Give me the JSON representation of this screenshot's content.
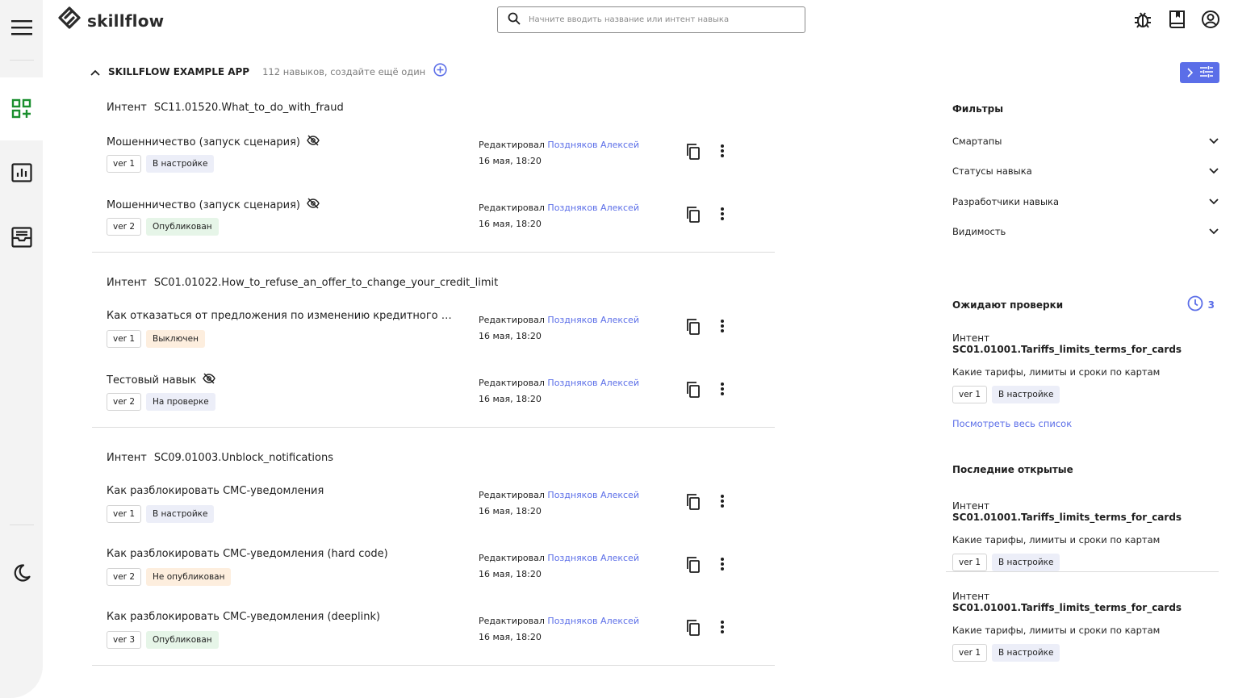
{
  "brand": {
    "name": "skillflow"
  },
  "search": {
    "placeholder": "Начните вводить название или интент навыка"
  },
  "header_icons": [
    "bug-icon",
    "book-icon",
    "account-icon"
  ],
  "nav": [
    "menu-icon",
    "apps-add-icon",
    "analytics-icon",
    "inbox-icon",
    "dark-mode-icon"
  ],
  "app": {
    "name": "SKILLFLOW EXAMPLE APP",
    "meta": "112 навыков, создайте ещё один"
  },
  "intent_label": "Интент",
  "edited_label": "Редактировал",
  "groups": [
    {
      "intent": "SC11.01520.What_to_do_with_fraud",
      "skills": [
        {
          "name": "Мошенничество (запуск сценария)",
          "hidden": true,
          "ver": "ver 1",
          "status": "В настройке",
          "status_kind": "setup",
          "editor": "Поздняков Алексей",
          "date": "16 мая, 18:20"
        },
        {
          "name": "Мошенничество (запуск сценария)",
          "hidden": true,
          "ver": "ver 2",
          "status": "Опубликован",
          "status_kind": "pub",
          "editor": "Поздняков Алексей",
          "date": "16 мая, 18:20"
        }
      ]
    },
    {
      "intent": "SC01.01022.How_to_refuse_an_offer_to_change_your_credit_limit",
      "skills": [
        {
          "name": "Как отказаться от предложения по изменению кредитного лимита",
          "hidden": false,
          "ver": "ver 1",
          "status": "Выключен",
          "status_kind": "off",
          "editor": "Поздняков Алексей",
          "date": "16 мая, 18:20"
        },
        {
          "name": "Тестовый навык",
          "hidden": true,
          "ver": "ver 2",
          "status": "На проверке",
          "status_kind": "review",
          "editor": "Поздняков Алексей",
          "date": "16 мая, 18:20"
        }
      ]
    },
    {
      "intent": "SC09.01003.Unblock_notifications",
      "skills": [
        {
          "name": "Как разблокировать СМС-уведомления",
          "hidden": false,
          "ver": "ver 1",
          "status": "В настройке",
          "status_kind": "setup",
          "editor": "Поздняков Алексей",
          "date": "16 мая, 18:20"
        },
        {
          "name": "Как разблокировать СМС-уведомления (hard code)",
          "hidden": false,
          "ver": "ver 2",
          "status": "Не опубликован",
          "status_kind": "off",
          "editor": "Поздняков Алексей",
          "date": "16 мая, 18:20"
        },
        {
          "name": "Как разблокировать СМС-уведомления (deeplink)",
          "hidden": false,
          "ver": "ver 3",
          "status": "Опубликован",
          "status_kind": "pub",
          "editor": "Поздняков Алексей",
          "date": "16 мая, 18:20"
        }
      ]
    }
  ],
  "filters": {
    "title": "Фильтры",
    "items": [
      "Смартапы",
      "Статусы навыка",
      "Разработчики навыка",
      "Видимость"
    ]
  },
  "pending": {
    "title": "Ожидают проверки",
    "count": "3",
    "card": {
      "intent_id": "SC01.01001.Tariffs_limits_terms_for_cards",
      "desc": "Какие тарифы, лимиты и сроки по картам",
      "ver": "ver 1",
      "status": "В настройке"
    },
    "see_all": "Посмотреть весь список"
  },
  "recent": {
    "title": "Последние открытые",
    "cards": [
      {
        "intent_id": "SC01.01001.Tariffs_limits_terms_for_cards",
        "desc": "Какие тарифы, лимиты и сроки по картам",
        "ver": "ver 1",
        "status": "В настройке"
      },
      {
        "intent_id": "SC01.01001.Tariffs_limits_terms_for_cards",
        "desc": "Какие тарифы, лимиты и сроки по картам",
        "ver": "ver 1",
        "status": "В настройке"
      }
    ]
  },
  "colors": {
    "accent": "#5b6ee8",
    "active_nav": "#1a8f2e",
    "published_bg": "#e6f5e8",
    "setup_bg": "#eceef8",
    "off_bg": "#fdeede"
  }
}
